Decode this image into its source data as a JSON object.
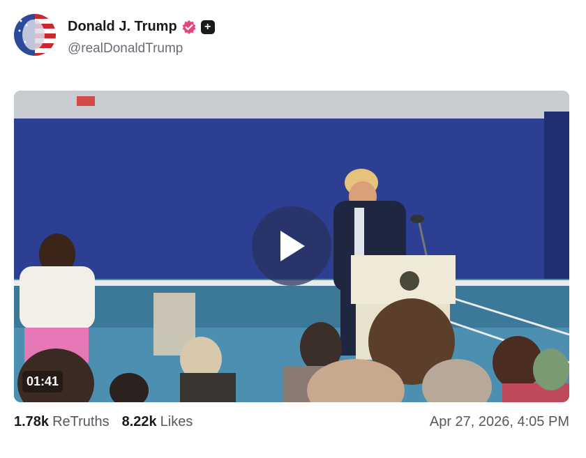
{
  "post": {
    "author_name": "Donald J. Trump",
    "verified_icon": "verified-badge-icon",
    "plus_icon": "plus-badge-icon",
    "handle": "@realDonaldTrump",
    "media": {
      "type": "video",
      "duration": "01:41",
      "play_icon": "play-icon"
    },
    "stats": {
      "retruths_count": "1.78k",
      "retruths_label": "ReTruths",
      "likes_count": "8.22k",
      "likes_label": "Likes"
    },
    "timestamp": "Apr 27, 2026, 4:05 PM"
  },
  "colors": {
    "badge": "#e8457a",
    "text": "#1a1a1a",
    "muted": "#555860"
  }
}
